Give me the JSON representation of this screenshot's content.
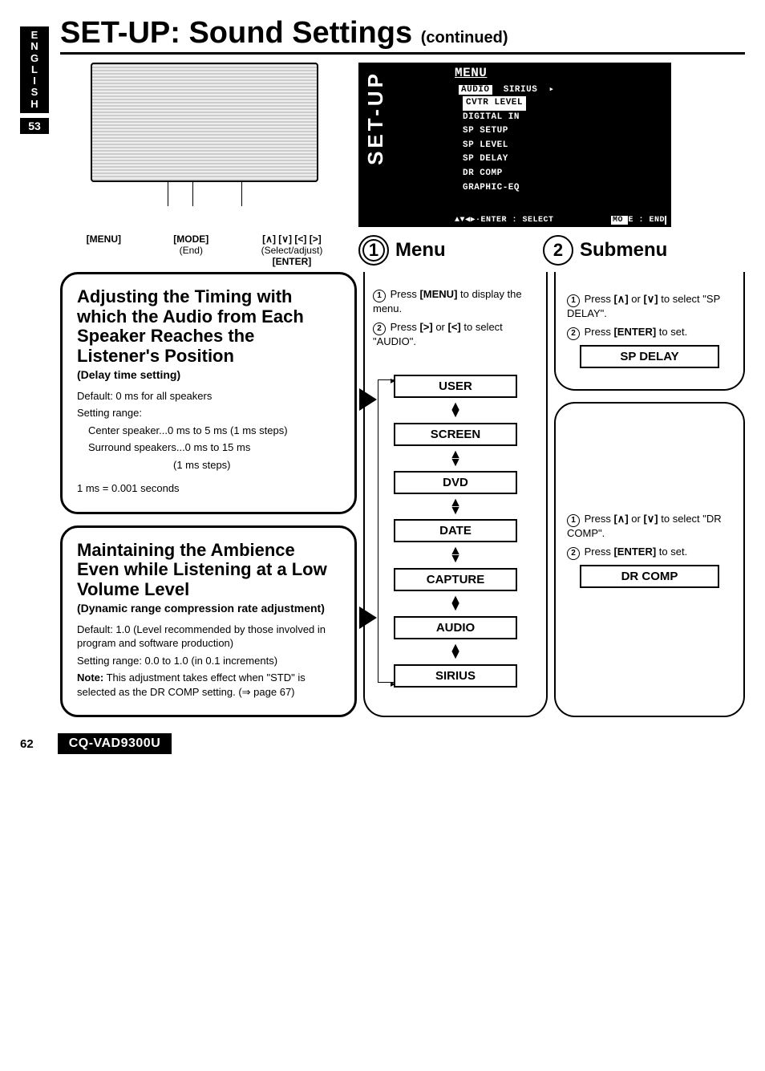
{
  "sidebar": {
    "language": "E\nN\nG\nL\nI\nS\nH",
    "side_page": "53"
  },
  "title": {
    "main": "SET-UP: Sound Settings",
    "cont": "(continued)"
  },
  "device": {
    "col1_a": "[MENU]",
    "col2_a": "[MODE]",
    "col2_b": "(End)",
    "col3_a": "[∧] [∨] [<] [>]",
    "col3_b": "(Select/adjust)",
    "col3_c": "[ENTER]"
  },
  "screen": {
    "setup": "SET-UP",
    "menu": "MENU",
    "tab_audio": "AUDIO",
    "tab_sirius": "SIRIUS",
    "items": [
      "CVTR LEVEL",
      "DIGITAL IN",
      "SP SETUP",
      "SP LEVEL",
      "SP DELAY",
      "DR COMP",
      "GRAPHIC-EQ"
    ],
    "footer_l": "▲▼◀▶·ENTER : SELECT",
    "footer_r1": "MO",
    "footer_r2": "E : END"
  },
  "heads": {
    "h1": "Menu",
    "h2": "Submenu",
    "n1": "1",
    "n2": "2"
  },
  "box1": {
    "title": "Adjusting the Timing with which the Audio from Each Speaker Reaches the Listener's Position",
    "sub": "(Delay time setting)",
    "l1": "Default: 0 ms for all speakers",
    "l2": "Setting range:",
    "l3": "Center speaker...0 ms to 5 ms (1 ms steps)",
    "l4": "Surround speakers...0 ms to 15 ms",
    "l5": "(1 ms steps)",
    "l6": "1 ms = 0.001 seconds"
  },
  "box2": {
    "title": "Maintaining the Ambience Even while Listening at a Low Volume Level",
    "sub": "(Dynamic range compression rate adjustment)",
    "l1": "Default: 1.0 (Level recommended by those involved in program and software production)",
    "l2": "Setting range: 0.0 to 1.0 (in 0.1 increments)",
    "note_k": "Note:",
    "note_t": " This adjustment takes effect when \"STD\" is selected as the DR COMP setting. (⇒ page 67)"
  },
  "flow": {
    "s1a": "Press ",
    "s1b": "[MENU]",
    "s1c": " to display the menu.",
    "s2a": "Press ",
    "s2b": "[>]",
    "s2c": " or ",
    "s2d": "[<]",
    "s2e": " to select \"AUDIO\".",
    "items": [
      "USER",
      "SCREEN",
      "DVD",
      "DATE",
      "CAPTURE",
      "AUDIO",
      "SIRIUS"
    ]
  },
  "sub1": {
    "s1a": "Press ",
    "s1b": "[∧]",
    "s1c": " or ",
    "s1d": "[∨]",
    "s1e": " to select \"SP DELAY\".",
    "s2a": "Press ",
    "s2b": "[ENTER]",
    "s2c": " to set.",
    "box": "SP DELAY"
  },
  "sub2": {
    "s1a": "Press ",
    "s1b": "[∧]",
    "s1c": " or ",
    "s1d": "[∨]",
    "s1e": " to select \"DR COMP\".",
    "s2a": "Press ",
    "s2b": "[ENTER]",
    "s2c": " to set.",
    "box": "DR COMP"
  },
  "footer": {
    "page": "62",
    "model": "CQ-VAD9300U"
  }
}
